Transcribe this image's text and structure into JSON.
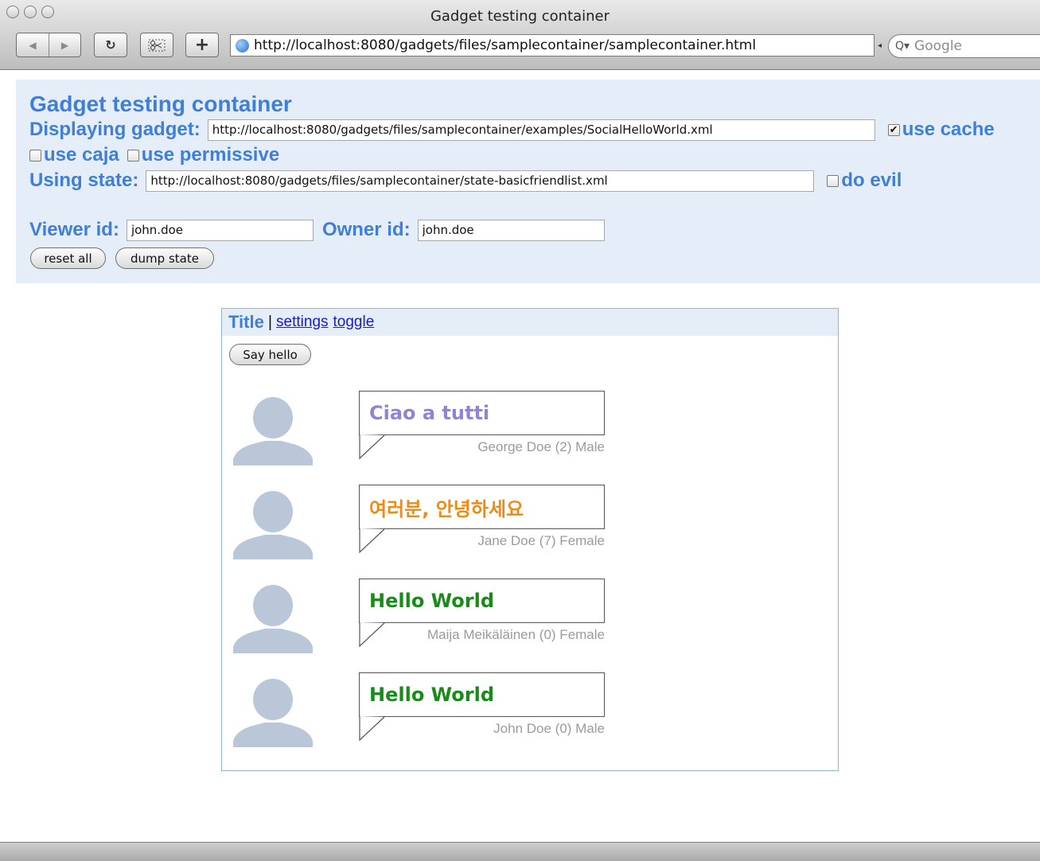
{
  "window": {
    "title": "Gadget testing container"
  },
  "browser": {
    "url": "http://localhost:8080/gadgets/files/samplecontainer/samplecontainer.html",
    "search_placeholder": "Google",
    "reload_glyph": "↻",
    "add_glyph": "+"
  },
  "panel": {
    "title": "Gadget testing container",
    "displaying_label": "Displaying gadget:",
    "gadget_url": "http://localhost:8080/gadgets/files/samplecontainer/examples/SocialHelloWorld.xml",
    "use_cache_label": "use cache",
    "use_cache_checked": true,
    "use_caja_label": "use caja",
    "use_permissive_label": "use permissive",
    "using_state_label": "Using state:",
    "state_url": "http://localhost:8080/gadgets/files/samplecontainer/state-basicfriendlist.xml",
    "do_evil_label": "do evil",
    "viewer_label": "Viewer id:",
    "viewer_id": "john.doe",
    "owner_label": "Owner id:",
    "owner_id": "john.doe",
    "reset_label": "reset all",
    "dump_label": "dump state"
  },
  "gadget": {
    "title": "Title",
    "separator": "|",
    "settings_label": "settings",
    "toggle_label": "toggle",
    "say_hello_label": "Say hello",
    "friends": [
      {
        "greeting": "Ciao a tutti",
        "color": "#8e86d0",
        "meta": "George Doe (2) Male"
      },
      {
        "greeting": "여러분, 안녕하세요",
        "color": "#f08a12",
        "meta": "Jane Doe (7) Female"
      },
      {
        "greeting": "Hello World",
        "color": "#1a8a1a",
        "meta": "Maija Meikäläinen (0) Female"
      },
      {
        "greeting": "Hello World",
        "color": "#1a8a1a",
        "meta": "John Doe (0) Male"
      }
    ]
  },
  "colors": {
    "accent": "#3f7fd7",
    "panel_bg": "#e5eef8",
    "avatar": "#bac7d8"
  }
}
